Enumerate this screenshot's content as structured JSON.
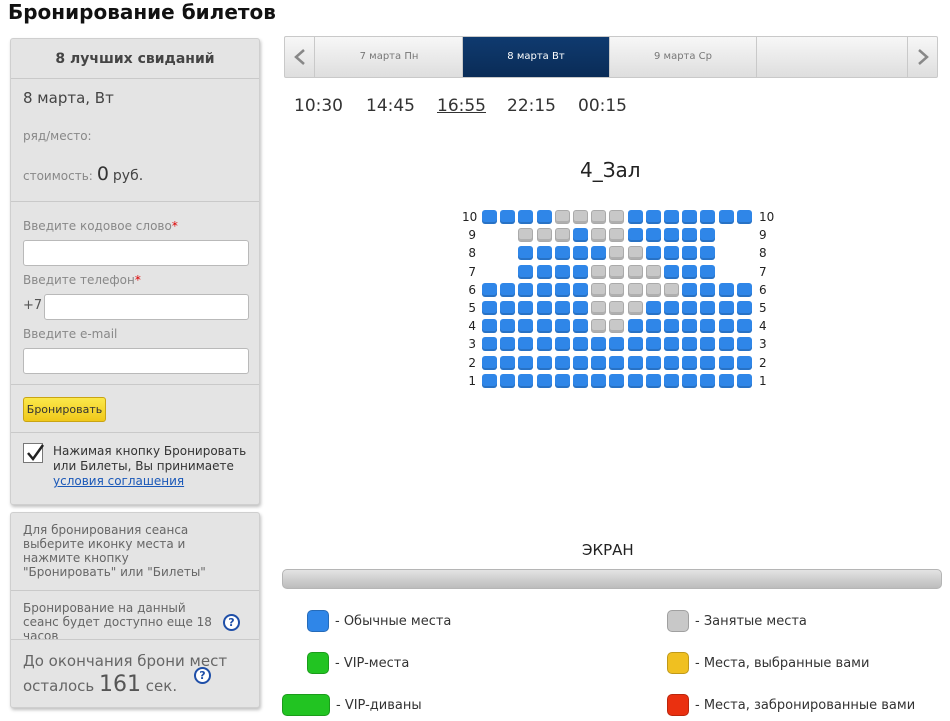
{
  "page_title": "Бронирование билетов",
  "booking": {
    "film_title": "8 лучших свиданий",
    "session_date": "8 марта, Вт",
    "seat_label": "ряд/место:",
    "cost_label": "стоимость:",
    "cost_value": "0",
    "cost_currency": "руб.",
    "code_label": "Введите кодовое слово",
    "phone_label": "Введите телефон",
    "required_mark": "*",
    "phone_prefix": "+7",
    "email_label": "Введите e-mail",
    "code_value": "",
    "phone_value": "",
    "email_value": "",
    "book_button": "Бронировать",
    "agree_text": "Нажимая кнопку Бронировать или Билеты, Вы принимаете",
    "agree_link": "условия соглашения",
    "agree_checked": true
  },
  "info": {
    "instruction": "Для бронирования сеанса выберите иконку места и нажмите кнопку \"Бронировать\" или \"Билеты\"",
    "availability": "Бронирование на данный сеанс будет доступно еще 18 часов",
    "timer_prefix": "До окончания брони мест осталось",
    "timer_value": "161",
    "timer_unit": "сек.",
    "help_glyph": "?"
  },
  "dates": [
    {
      "label": "7 марта Пн",
      "active": false
    },
    {
      "label": "8 марта Вт",
      "active": true
    },
    {
      "label": "9 марта Ср",
      "active": false
    },
    {
      "label": "",
      "active": false
    }
  ],
  "times": [
    {
      "label": "10:30",
      "active": false
    },
    {
      "label": "14:45",
      "active": false
    },
    {
      "label": "16:55",
      "active": true
    },
    {
      "label": "22:15",
      "active": false
    },
    {
      "label": "00:15",
      "active": false
    }
  ],
  "hall": {
    "name": "4_Зал",
    "screen_label": "ЭКРАН",
    "rows": [
      {
        "number": "10",
        "seats": [
          "free",
          "free",
          "free",
          "free",
          "taken",
          "taken",
          "taken",
          "taken",
          "free",
          "free",
          "free",
          "free",
          "free",
          "free",
          "free"
        ]
      },
      {
        "number": "9",
        "seats": [
          "taken",
          "taken",
          "taken",
          "free",
          "taken",
          "taken",
          "free",
          "free",
          "free",
          "free",
          "free"
        ]
      },
      {
        "number": "8",
        "seats": [
          "free",
          "free",
          "free",
          "free",
          "free",
          "taken",
          "taken",
          "free",
          "free",
          "free",
          "free"
        ]
      },
      {
        "number": "7",
        "seats": [
          "free",
          "free",
          "free",
          "free",
          "taken",
          "taken",
          "taken",
          "taken",
          "free",
          "free",
          "free"
        ]
      },
      {
        "number": "6",
        "seats": [
          "free",
          "free",
          "free",
          "free",
          "free",
          "free",
          "taken",
          "taken",
          "taken",
          "taken",
          "taken",
          "free",
          "free",
          "free",
          "free"
        ]
      },
      {
        "number": "5",
        "seats": [
          "free",
          "free",
          "free",
          "free",
          "free",
          "free",
          "taken",
          "taken",
          "taken",
          "free",
          "free",
          "free",
          "free",
          "free",
          "free"
        ]
      },
      {
        "number": "4",
        "seats": [
          "free",
          "free",
          "free",
          "free",
          "free",
          "free",
          "taken",
          "taken",
          "free",
          "free",
          "free",
          "free",
          "free",
          "free",
          "free"
        ]
      },
      {
        "number": "3",
        "seats": [
          "free",
          "free",
          "free",
          "free",
          "free",
          "free",
          "free",
          "free",
          "free",
          "free",
          "free",
          "free",
          "free",
          "free",
          "free"
        ]
      },
      {
        "number": "2",
        "seats": [
          "free",
          "free",
          "free",
          "free",
          "free",
          "free",
          "free",
          "free",
          "free",
          "free",
          "free",
          "free",
          "free",
          "free",
          "free"
        ]
      },
      {
        "number": "1",
        "seats": [
          "free",
          "free",
          "free",
          "free",
          "free",
          "free",
          "free",
          "free",
          "free",
          "free",
          "free",
          "free",
          "free",
          "free",
          "free"
        ]
      }
    ]
  },
  "legend": [
    {
      "label": "- Обычные места",
      "color": "#2f86e8",
      "wide": false
    },
    {
      "label": "- Занятые места",
      "color": "#c8c8c8",
      "wide": false
    },
    {
      "label": "- VIP-места",
      "color": "#22c422",
      "wide": false
    },
    {
      "label": "- Места, выбранные вами",
      "color": "#f0c020",
      "wide": false
    },
    {
      "label": "- VIP-диваны",
      "color": "#22c422",
      "wide": true
    },
    {
      "label": "- Места, забронированные вами",
      "color": "#ea3010",
      "wide": false
    }
  ],
  "icons": {
    "prev": "chevron-left-icon",
    "next": "chevron-right-icon",
    "check": "checkmark-icon",
    "help": "help-icon"
  }
}
